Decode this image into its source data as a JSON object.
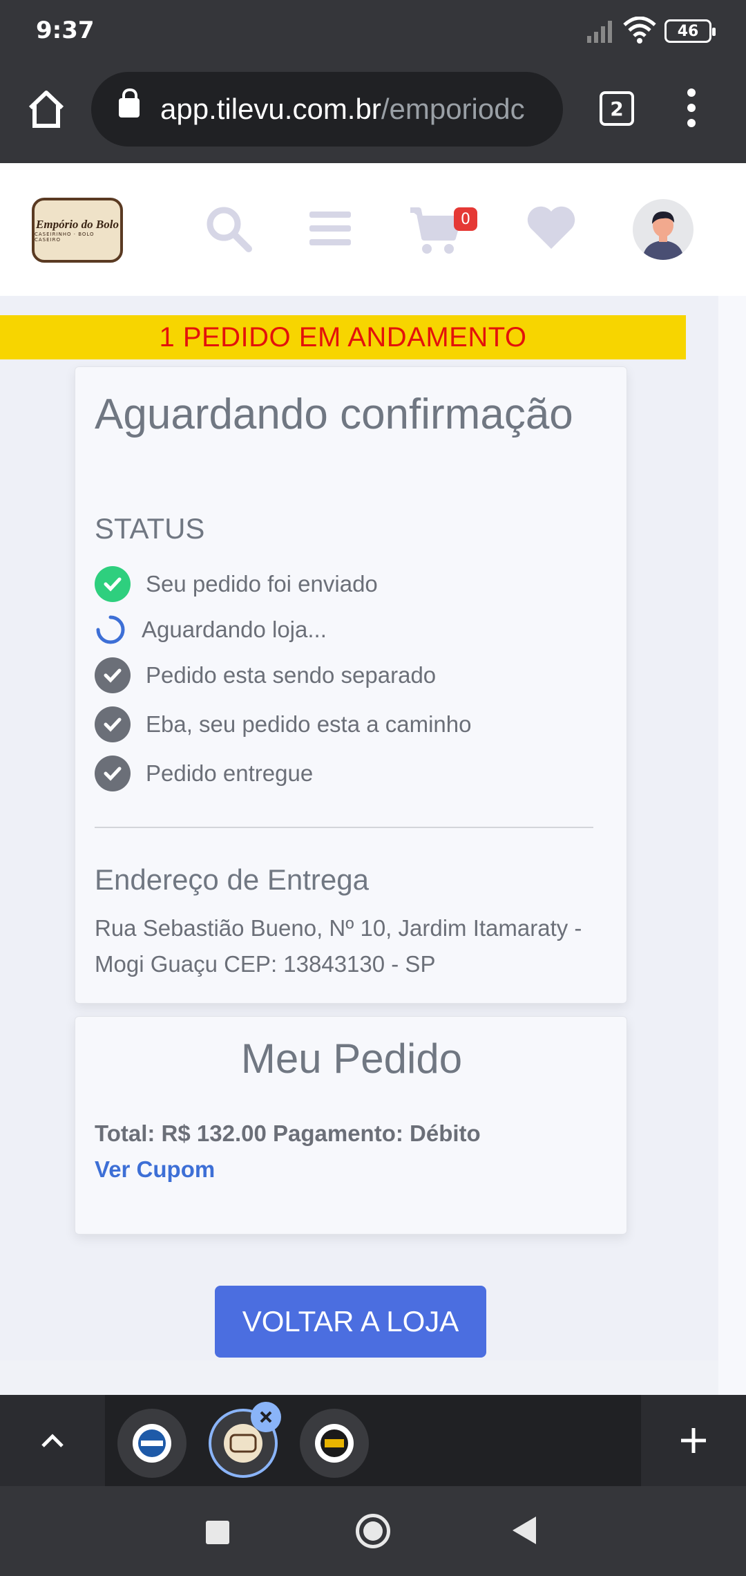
{
  "status_bar": {
    "time": "9:37",
    "battery": "46"
  },
  "browser": {
    "url_host": "app.tilevu.com.br",
    "url_path": "/emporiodc",
    "tab_count": "2"
  },
  "header": {
    "logo_name": "Empório do Bolo",
    "logo_sub": "CASEIRINHO · BOLO CASEIRO",
    "cart_count": "0"
  },
  "banner": "1 PEDIDO EM ANDAMENTO",
  "order": {
    "title": "Aguardando confirmação",
    "status_header": "STATUS",
    "steps": [
      {
        "label": "Seu pedido foi enviado",
        "state": "done"
      },
      {
        "label": "Aguardando loja...",
        "state": "loading"
      },
      {
        "label": "Pedido esta sendo separado",
        "state": "pending"
      },
      {
        "label": "Eba, seu pedido esta a caminho",
        "state": "pending"
      },
      {
        "label": "Pedido entregue",
        "state": "pending"
      }
    ],
    "address_header": "Endereço de Entrega",
    "address": "Rua Sebastião Bueno, Nº 10, Jardim Itamaraty - Mogi Guaçu CEP: 13843130 - SP"
  },
  "summary": {
    "title": "Meu Pedido",
    "total_line": "Total: R$ 132.00 Pagamento: Débito",
    "coupon_link": "Ver Cupom"
  },
  "back_button": "VOLTAR A LOJA",
  "colors": {
    "accent": "#4b6ee0",
    "banner_bg": "#f7d500",
    "banner_text": "#e3120b",
    "done_green": "#2ecf7e",
    "link_blue": "#3d6fd6"
  }
}
